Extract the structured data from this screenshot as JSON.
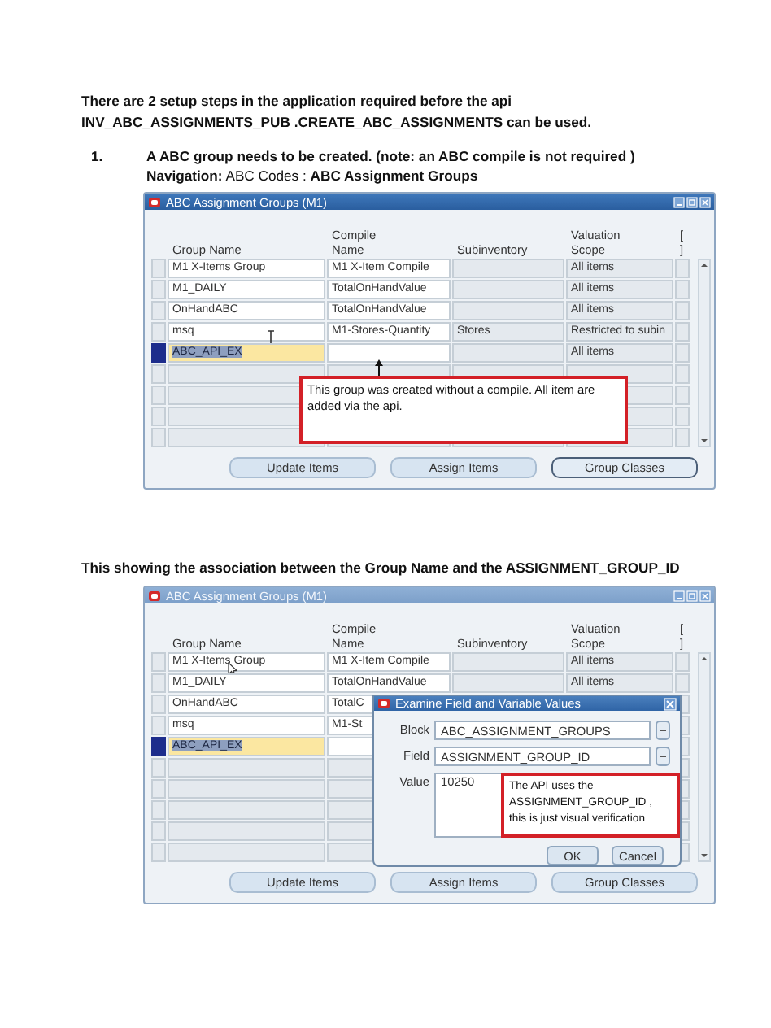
{
  "intro": "There are 2 setup steps in the application required  before the api\nINV_ABC_ASSIGNMENTS_PUB .CREATE_ABC_ASSIGNMENTS can be used.",
  "steps": [
    {
      "number": "1.",
      "text": "A ABC group needs to be created. (note: an  ABC compile is not required )",
      "navigation": "**Navigation:**  ABC Codes  :  **ABC Assignment Groups**"
    }
  ],
  "windows": [
    {
      "title": "ABC Assignment Groups (M1)",
      "active": true,
      "columns": [
        "Group Name",
        "Compile Name",
        "Subinventory",
        "Valuation Scope",
        "[ ]"
      ],
      "rows": [
        {
          "group_name": "M1 X-Items Group",
          "compile_name": "M1 X-Item Compile",
          "valuation_scope": "All items",
          "selected": false
        },
        {
          "group_name": "M1_DAILY",
          "compile_name": "TotalOnHandValue",
          "valuation_scope": "All items",
          "selected": false
        },
        {
          "group_name": "OnHandABC",
          "compile_name": "TotalOnHandValue",
          "valuation_scope": "All items",
          "selected": false
        },
        {
          "group_name": "msq",
          "compile_name": "M1-Stores-Quantity",
          "subinventory": "Stores",
          "valuation_scope": "Restricted to subin",
          "selected": false,
          "text_cursor": true
        },
        {
          "group_name": "ABC_API_EX",
          "valuation_scope": "All items",
          "selected": true
        }
      ],
      "callout": "This group was created without a compile. All item are added via the api.",
      "buttons": [
        {
          "label": "Update Items",
          "focused": false
        },
        {
          "label": "Assign Items",
          "focused": false
        },
        {
          "label": "Group Classes",
          "focused": true
        }
      ]
    },
    {
      "caption": "This showing the association between the Group Name and the ASSIGNMENT_GROUP_ID",
      "title": "ABC Assignment Groups (M1)",
      "active": false,
      "columns": [
        "Group Name",
        "Compile Name",
        "Subinventory",
        "Valuation Scope",
        "[ ]"
      ],
      "rows": [
        {
          "group_name": "M1 X-Items Group",
          "compile_name": "M1 X-Item Compile",
          "valuation_scope": "All items",
          "selected": false,
          "mouse_pointer": true
        },
        {
          "group_name": "M1_DAILY",
          "compile_name": "TotalOnHandValue",
          "valuation_scope": "All items",
          "selected": false
        },
        {
          "group_name": "OnHandABC",
          "compile_name": "TotalC",
          "selected": false
        },
        {
          "group_name": "msq",
          "compile_name": "M1-St",
          "selected": false
        },
        {
          "group_name": "ABC_API_EX",
          "selected": true
        }
      ],
      "dialog": {
        "title": "Examine Field and Variable Values",
        "fields": [
          {
            "kind": "line",
            "label": "Block",
            "value": "ABC_ASSIGNMENT_GROUPS"
          },
          {
            "kind": "line",
            "label": "Field",
            "value": "ASSIGNMENT_GROUP_ID"
          },
          {
            "kind": "area",
            "label": "Value",
            "value": "10250"
          }
        ],
        "buttons": [
          "OK",
          "Cancel"
        ],
        "callout": "The API uses the ASSIGNMENT_GROUP_ID , this is just  visual verification"
      },
      "buttons": [
        {
          "label": "Update Items",
          "focused": false
        },
        {
          "label": "Assign Items",
          "focused": false
        },
        {
          "label": "Group Classes",
          "focused": false
        }
      ]
    }
  ]
}
